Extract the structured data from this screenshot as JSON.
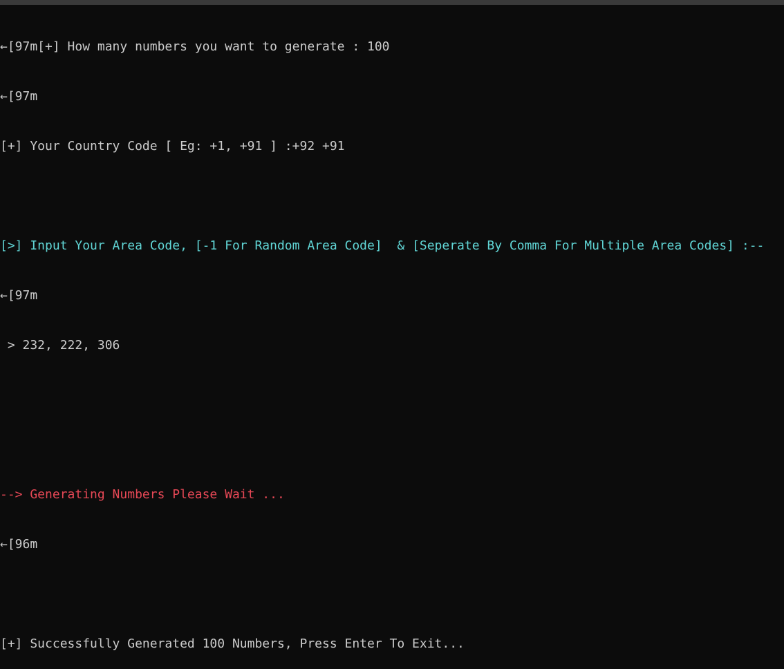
{
  "colors": {
    "background": "#0c0c0c",
    "text_default": "#cccccc",
    "text_cyan": "#61d6d6",
    "text_red": "#e74856"
  },
  "terminal": {
    "lines": [
      {
        "text": "←[97m[+] How many numbers you want to generate : 100",
        "color": "white"
      },
      {
        "text": "←[97m",
        "color": "white"
      },
      {
        "text": "[+] Your Country Code [ Eg: +1, +91 ] :+92 +91",
        "color": "white"
      },
      {
        "text": "",
        "color": "white"
      },
      {
        "text": "[>] Input Your Area Code, [-1 For Random Area Code]  & [Seperate By Comma For Multiple Area Codes] :--",
        "color": "cyan"
      },
      {
        "text": "←[97m",
        "color": "white"
      },
      {
        "text": " > 232, 222, 306",
        "color": "white"
      },
      {
        "text": "",
        "color": "white"
      },
      {
        "text": "",
        "color": "white"
      },
      {
        "text": "--> Generating Numbers Please Wait ...",
        "color": "red"
      },
      {
        "text": "←[96m",
        "color": "white"
      },
      {
        "text": "",
        "color": "white"
      },
      {
        "text": "[+] Successfully Generated 100 Numbers, Press Enter To Exit...",
        "color": "white"
      }
    ]
  }
}
